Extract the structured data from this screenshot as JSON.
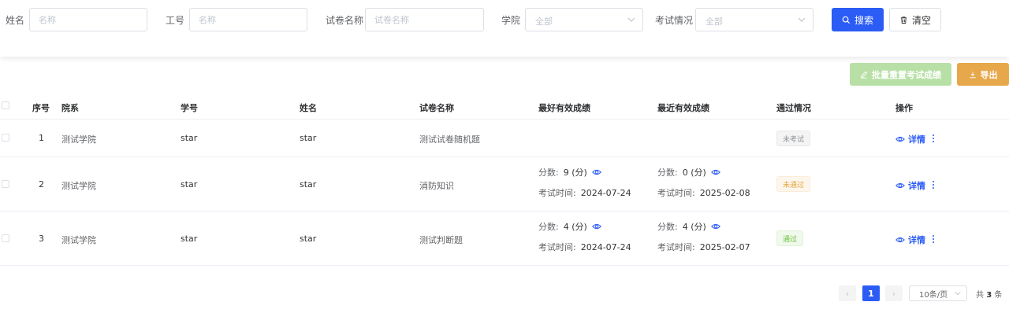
{
  "filters": {
    "name_label": "姓名",
    "name_placeholder": "名称",
    "id_label": "工号",
    "id_placeholder": "名称",
    "paper_label": "试卷名称",
    "paper_placeholder": "试卷名称",
    "college_label": "学院",
    "college_value": "全部",
    "exam_label": "考试情况",
    "exam_value": "全部",
    "search_label": "搜索",
    "clear_label": "清空"
  },
  "actions": {
    "batch_reset_label": "批量重置考试成绩",
    "export_label": "导出"
  },
  "table": {
    "headers": {
      "index": "序号",
      "college": "院系",
      "student_id": "学号",
      "name": "姓名",
      "paper": "试卷名称",
      "best": "最好有效成绩",
      "recent": "最近有效成绩",
      "status": "通过情况",
      "ops": "操作"
    },
    "score_prefix": "分数:",
    "time_prefix": "考试时间:",
    "detail_label": "详情",
    "rows": [
      {
        "index": "1",
        "college": "测试学院",
        "student_id": "star",
        "name": "star",
        "paper": "测试试卷随机题",
        "status": "未考试"
      },
      {
        "index": "2",
        "college": "测试学院",
        "student_id": "star",
        "name": "star",
        "paper": "消防知识",
        "best_score": "9 (分)",
        "best_time": "2024-07-24",
        "recent_score": "0 (分)",
        "recent_time": "2025-02-08",
        "status": "未通过"
      },
      {
        "index": "3",
        "college": "测试学院",
        "student_id": "star",
        "name": "star",
        "paper": "测试判断题",
        "best_score": "4 (分)",
        "best_time": "2024-07-24",
        "recent_score": "4 (分)",
        "recent_time": "2025-02-07",
        "status": "通过"
      }
    ]
  },
  "pagination": {
    "prev": "‹",
    "current": "1",
    "next": "›",
    "page_size": "10条/页",
    "total_prefix": "共",
    "total_count": "3",
    "total_suffix": "条"
  },
  "colors": {
    "primary": "#2b5cf6",
    "batch_button": "#b8e0a6",
    "export_button": "#e6a84a",
    "status_not_taken": "#909399",
    "status_failed": "#e6a23c",
    "status_passed": "#67c23a"
  },
  "icons": {
    "search": "search-icon",
    "clear": "trash-icon",
    "batch": "edit-icon",
    "export": "download-icon",
    "score_view": "eye-icon",
    "more": "more-vertical-icon",
    "select": "chevron-down-icon"
  }
}
